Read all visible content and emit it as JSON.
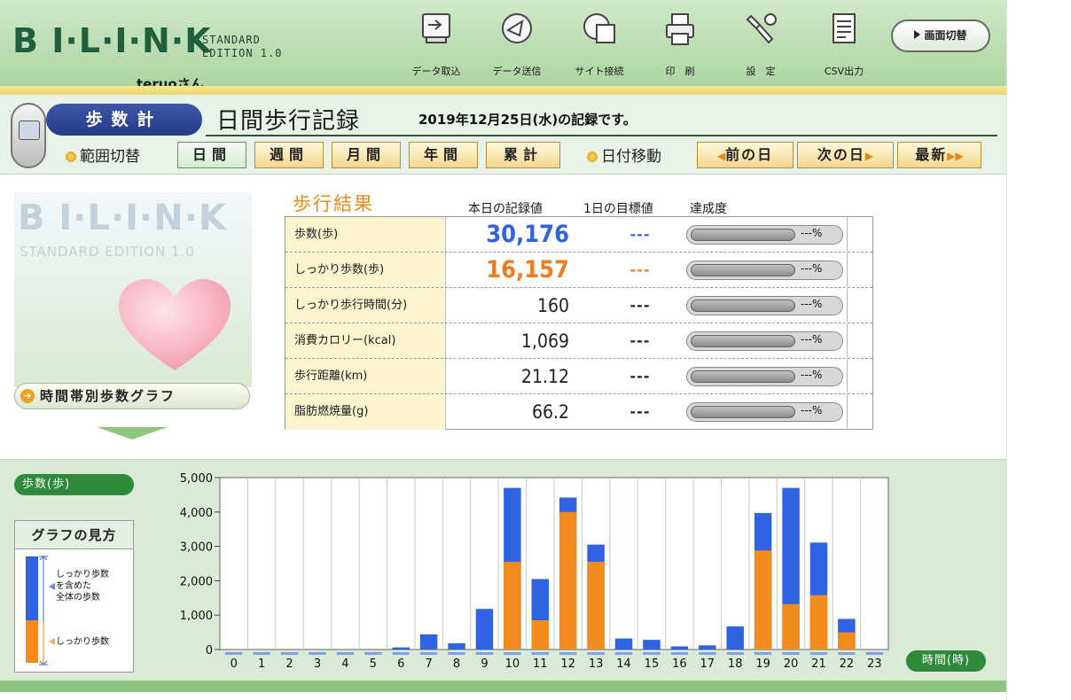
{
  "app": {
    "logo_main": "B I·L·I·N·K",
    "logo_edition_line1": "STANDARD",
    "logo_edition_line2": "EDITION 1.0",
    "user": "teruoさん"
  },
  "toolbar": [
    {
      "label": "データ取込",
      "icon": "data-import-icon"
    },
    {
      "label": "データ送信",
      "icon": "data-send-icon"
    },
    {
      "label": "サイト接続",
      "icon": "site-connect-icon"
    },
    {
      "label": "印　刷",
      "icon": "printer-icon"
    },
    {
      "label": "設　定",
      "icon": "settings-icon"
    },
    {
      "label": "CSV出力",
      "icon": "csv-export-icon"
    }
  ],
  "screen_switch_label": "画面切替",
  "module_label": "歩数計",
  "page_title": "日間歩行記録",
  "record_note": "2019年12月25日(水)の記録です。",
  "range_label": "範囲切替",
  "range_tabs": [
    {
      "label": "日間",
      "active": true
    },
    {
      "label": "週間",
      "active": false
    },
    {
      "label": "月間",
      "active": false
    },
    {
      "label": "年間",
      "active": false
    },
    {
      "label": "累計",
      "active": false
    }
  ],
  "date_label": "日付移動",
  "date_buttons": {
    "prev": "前の日",
    "next": "次の日",
    "latest": "最新"
  },
  "left_panel": {
    "art_logo": "B I·L·I·N·K",
    "art_edition": "STANDARD EDITION 1.0",
    "hourly_graph_button": "時間帯別歩数グラフ"
  },
  "results": {
    "title": "歩行結果",
    "col_today": "本日の記録値",
    "col_goal": "1日の目標値",
    "col_achievement": "達成度",
    "rows": [
      {
        "name": "歩数(歩)",
        "value": "30,176",
        "goal": "---",
        "pct": "---%",
        "color": "#2f63e2",
        "big": true
      },
      {
        "name": "しっかり歩数(歩)",
        "value": "16,157",
        "goal": "---",
        "pct": "---%",
        "color": "#f27a1a",
        "big": true
      },
      {
        "name": "しっかり歩行時間(分)",
        "value": "160",
        "goal": "---",
        "pct": "---%",
        "color": "#222",
        "big": false
      },
      {
        "name": "消費カロリー(kcal)",
        "value": "1,069",
        "goal": "---",
        "pct": "---%",
        "color": "#222",
        "big": false
      },
      {
        "name": "歩行距離(km)",
        "value": "21.12",
        "goal": "---",
        "pct": "---%",
        "color": "#222",
        "big": false
      },
      {
        "name": "脂肪燃焼量(g)",
        "value": "66.2",
        "goal": "---",
        "pct": "---%",
        "color": "#222",
        "big": false
      }
    ]
  },
  "legend": {
    "title": "グラフの見方",
    "total_text": "しっかり歩数\nを含めた\n全体の歩数",
    "firm_text": "しっかり歩数"
  },
  "chart_data": {
    "type": "bar",
    "stacked": true,
    "ylabel": "歩数(歩)",
    "xlabel": "時間(時)",
    "ylim": [
      0,
      5000
    ],
    "yticks": [
      "0",
      "1,000",
      "2,000",
      "3,000",
      "4,000",
      "5,000"
    ],
    "categories": [
      "0",
      "1",
      "2",
      "3",
      "4",
      "5",
      "6",
      "7",
      "8",
      "9",
      "10",
      "11",
      "12",
      "13",
      "14",
      "15",
      "16",
      "17",
      "18",
      "19",
      "20",
      "21",
      "22",
      "23"
    ],
    "series": [
      {
        "name": "しっかり歩数",
        "color": "#f28c1e",
        "values": [
          0,
          0,
          0,
          0,
          0,
          0,
          0,
          0,
          0,
          0,
          2550,
          850,
          4000,
          2550,
          0,
          0,
          0,
          0,
          0,
          2880,
          1320,
          1580,
          500,
          0
        ]
      },
      {
        "name": "全体の歩数",
        "color": "#2f63e2",
        "values": [
          0,
          0,
          0,
          0,
          0,
          0,
          60,
          440,
          180,
          1180,
          4700,
          2050,
          4420,
          3050,
          320,
          280,
          90,
          120,
          670,
          3970,
          4700,
          3110,
          890,
          0
        ]
      }
    ],
    "grid": true
  }
}
